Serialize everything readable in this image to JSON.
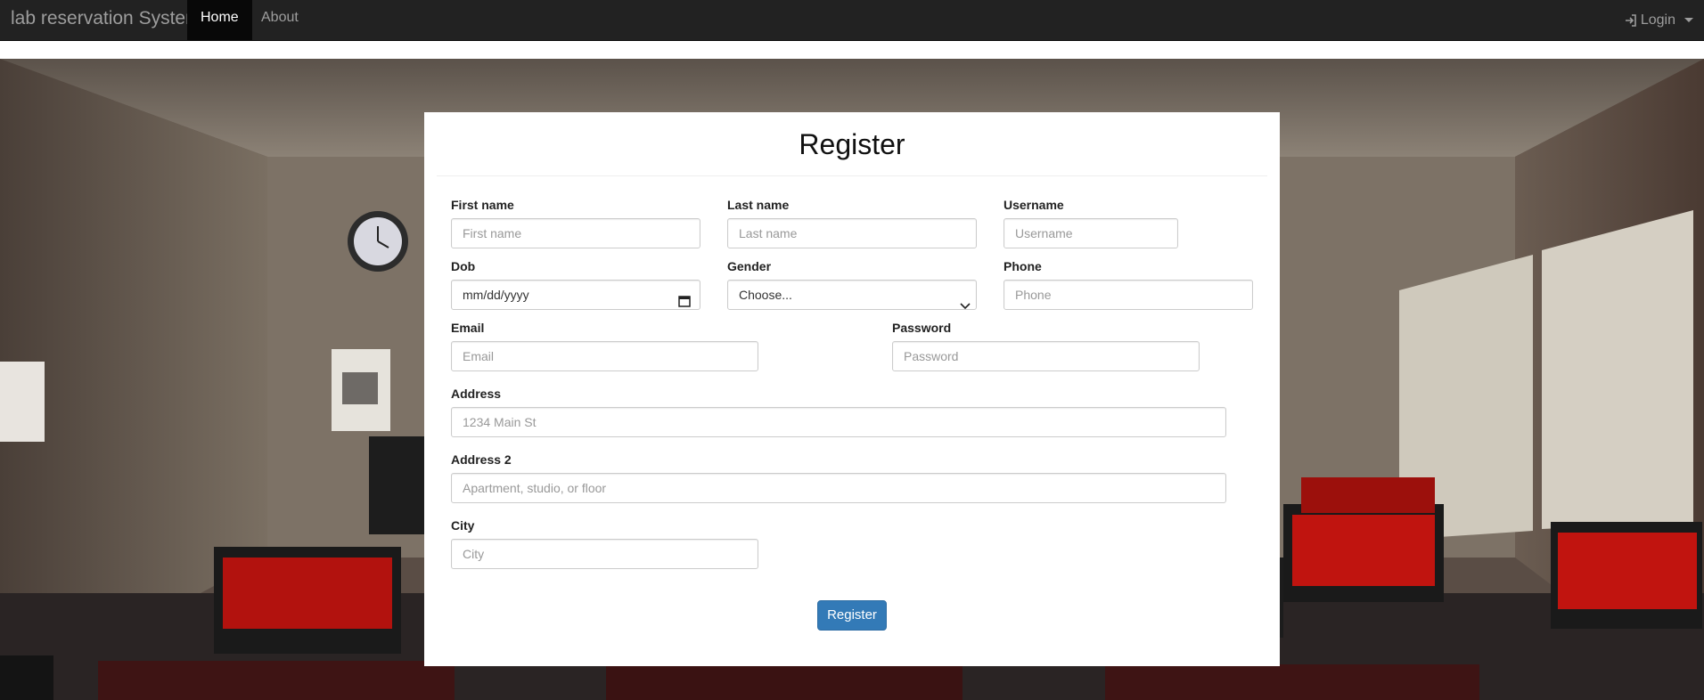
{
  "navbar": {
    "brand": "lab reservation System",
    "items": [
      {
        "label": "Home",
        "active": true
      },
      {
        "label": "About",
        "active": false
      }
    ],
    "login_label": "Login",
    "login_icon": "sign-in-icon"
  },
  "form": {
    "title": "Register",
    "fields": {
      "first_name": {
        "label": "First name",
        "placeholder": "First name"
      },
      "last_name": {
        "label": "Last name",
        "placeholder": "Last name"
      },
      "username": {
        "label": "Username",
        "placeholder": "Username"
      },
      "dob": {
        "label": "Dob",
        "value": "mm/dd/yyyy"
      },
      "gender": {
        "label": "Gender",
        "selected": "Choose..."
      },
      "phone": {
        "label": "Phone",
        "placeholder": "Phone"
      },
      "email": {
        "label": "Email",
        "placeholder": "Email"
      },
      "password": {
        "label": "Password",
        "placeholder": "Password"
      },
      "address": {
        "label": "Address",
        "placeholder": "1234 Main St"
      },
      "address2": {
        "label": "Address 2",
        "placeholder": "Apartment, studio, or floor"
      },
      "city": {
        "label": "City",
        "placeholder": "City"
      }
    },
    "submit_label": "Register"
  },
  "colors": {
    "navbar_bg": "#222222",
    "navbar_active": "#080808",
    "primary_button": "#337ab7"
  }
}
